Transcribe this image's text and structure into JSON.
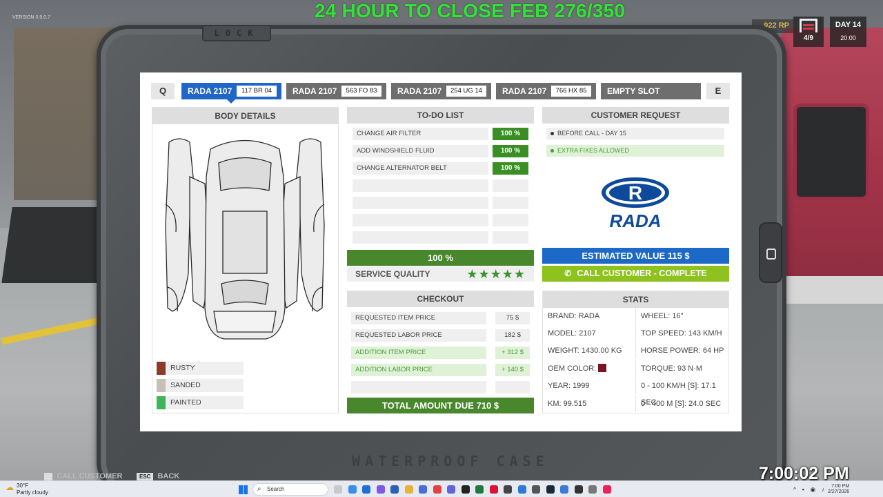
{
  "overlay": {
    "banner": "24 HOUR TO CLOSE FEB 276/350",
    "version": "VERSION 0.9.0.7",
    "clock": "7:00:02 PM"
  },
  "hud": {
    "rp": "922 RP",
    "garage_count": "4/9",
    "day": "DAY 14",
    "time": "20:00"
  },
  "case": {
    "lock_label": "LOCK",
    "footer_label": "WATERPROOF CASE"
  },
  "tabs": {
    "prev_key": "Q",
    "next_key": "E",
    "items": [
      {
        "model": "RADA 2107",
        "plate": "117 BR 04",
        "active": true
      },
      {
        "model": "RADA 2107",
        "plate": "563 FO 83",
        "active": false
      },
      {
        "model": "RADA 2107",
        "plate": "254 UG 14",
        "active": false
      },
      {
        "model": "RADA 2107",
        "plate": "766 HX 85",
        "active": false
      },
      {
        "model": "EMPTY SLOT",
        "plate": "",
        "active": false
      }
    ]
  },
  "body_details": {
    "title": "BODY DETAILS",
    "legend": [
      {
        "label": "RUSTY",
        "color": "#8b3a2a"
      },
      {
        "label": "SANDED",
        "color": "#c7bfb3"
      },
      {
        "label": "PAINTED",
        "color": "#3fb55a"
      }
    ]
  },
  "todo": {
    "title": "TO-DO LIST",
    "items": [
      {
        "name": "CHANGE AIR FILTER",
        "pct": "100 %"
      },
      {
        "name": "ADD WINDSHIELD FLUID",
        "pct": "100 %"
      },
      {
        "name": "CHANGE ALTERNATOR BELT",
        "pct": "100 %"
      }
    ],
    "total": "100 %",
    "service_quality_label": "SERVICE QUALITY",
    "service_quality_stars": 5
  },
  "customer": {
    "title": "CUSTOMER REQUEST",
    "requests": [
      "BEFORE CALL - DAY 15",
      "EXTRA FIXES ALLOWED"
    ],
    "brand_logo": "RADA",
    "estimated_value": "ESTIMATED VALUE 115 $",
    "call_button": "CALL CUSTOMER - COMPLETE"
  },
  "checkout": {
    "title": "CHECKOUT",
    "rows": [
      {
        "name": "REQUESTED ITEM PRICE",
        "value": "75 $",
        "highlight": false
      },
      {
        "name": "REQUESTED LABOR PRICE",
        "value": "182 $",
        "highlight": false
      },
      {
        "name": "ADDITION ITEM PRICE",
        "value": "+ 312 $",
        "highlight": true
      },
      {
        "name": "ADDITION LABOR PRICE",
        "value": "+ 140 $",
        "highlight": true
      }
    ],
    "total": "TOTAL AMOUNT DUE 710 $"
  },
  "stats": {
    "title": "STATS",
    "left": [
      "BRAND: RADA",
      "MODEL: 2107",
      "WEIGHT: 1430.00 KG",
      "OEM COLOR:",
      "YEAR: 1999",
      "KM: 99.515"
    ],
    "right": [
      "WHEEL: 16\"",
      "TOP SPEED: 143 KM/H",
      "HORSE POWER: 64 HP",
      "TORQUE: 93 N·M",
      "0 - 100 KM/H [S]: 17.1 SEC",
      "0 - 400 M [S]: 24.0 SEC"
    ],
    "oem_color": "#7a1424"
  },
  "hints": {
    "call_label": "CALL CUSTOMER",
    "back_key": "ESC",
    "back_label": "BACK"
  },
  "taskbar": {
    "weather_temp": "30°F",
    "weather_desc": "Partly cloudy",
    "search_placeholder": "Search",
    "time": "7:00 PM",
    "date": "2/27/2026"
  },
  "colors": {
    "accent_blue": "#1f66c8",
    "complete_green": "#48872b",
    "call_green": "#8ec21d",
    "banner_green": "#36e03a"
  }
}
